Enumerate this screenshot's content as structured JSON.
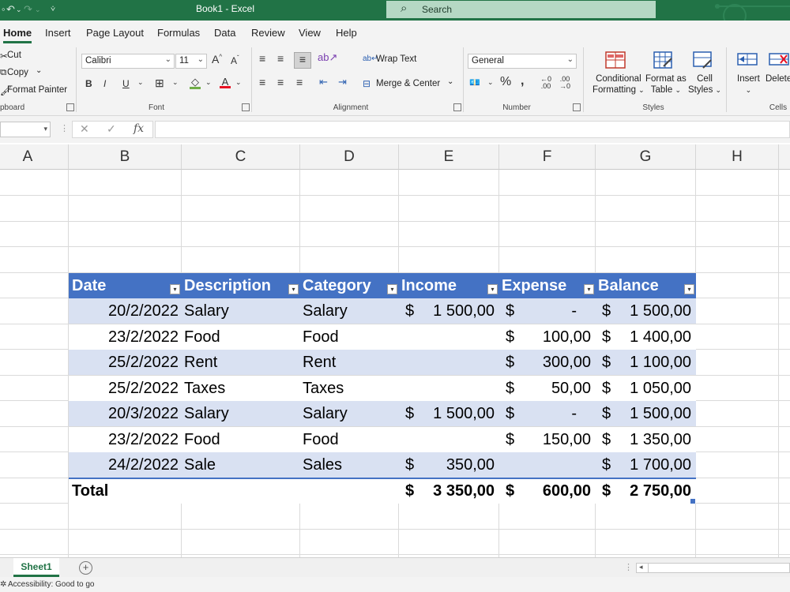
{
  "titlebar": {
    "title": "Book1  -  Excel",
    "search_placeholder": "Search",
    "accent": "#217346",
    "qa_undo": "↶",
    "qa_redo": "↷",
    "qa_more": "⩒"
  },
  "ribbon_tabs": [
    "Home",
    "Insert",
    "Page Layout",
    "Formulas",
    "Data",
    "Review",
    "View",
    "Help"
  ],
  "clipboard": {
    "cut": "Cut",
    "copy": "Copy",
    "format_painter": "Format Painter",
    "label": "pboard"
  },
  "font": {
    "name": "Calibri",
    "size": "11",
    "label": "Font",
    "bold": "B",
    "italic": "I",
    "underline": "U",
    "grow": "A",
    "shrink": "A"
  },
  "alignment": {
    "wrap_text": "Wrap Text",
    "merge_center": "Merge & Center",
    "label": "Alignment"
  },
  "number": {
    "format": "General",
    "label": "Number"
  },
  "styles": {
    "conditional_formatting": [
      "Conditional",
      "Formatting"
    ],
    "format_as_table": [
      "Format as",
      "Table"
    ],
    "cell_styles": [
      "Cell",
      "Styles"
    ],
    "label": "Styles"
  },
  "cells": {
    "insert": "Insert",
    "delete": "Delete",
    "label": "Cells"
  },
  "formula_bar": {
    "name_box": "",
    "fx": "fx",
    "cancel": "✕",
    "enter": "✓",
    "value": ""
  },
  "columns": [
    "A",
    "B",
    "C",
    "D",
    "E",
    "F",
    "G",
    "H"
  ],
  "table": {
    "header_color": "#4472c4",
    "band_color": "#d9e1f2",
    "headers": [
      "Date",
      "Description",
      "Category",
      "Income",
      "Expense",
      "Balance"
    ],
    "rows": [
      {
        "date": "20/2/2022",
        "description": "Salary",
        "category": "Salary",
        "income": "1 500,00",
        "expense": "-",
        "balance": "1 500,00"
      },
      {
        "date": "23/2/2022",
        "description": "Food",
        "category": "Food",
        "income": "",
        "expense": "100,00",
        "balance": "1 400,00"
      },
      {
        "date": "25/2/2022",
        "description": "Rent",
        "category": "Rent",
        "income": "",
        "expense": "300,00",
        "balance": "1 100,00"
      },
      {
        "date": "25/2/2022",
        "description": "Taxes",
        "category": "Taxes",
        "income": "",
        "expense": "50,00",
        "balance": "1 050,00"
      },
      {
        "date": "20/3/2022",
        "description": "Salary",
        "category": "Salary",
        "income": "1 500,00",
        "expense": "-",
        "balance": "1 500,00"
      },
      {
        "date": "23/2/2022",
        "description": "Food",
        "category": "Food",
        "income": "",
        "expense": "150,00",
        "balance": "1 350,00"
      },
      {
        "date": "24/2/2022",
        "description": "Sale",
        "category": "Sales",
        "income": "350,00",
        "expense": "",
        "balance": "1 700,00"
      }
    ],
    "total": {
      "label": "Total",
      "income": "3 350,00",
      "expense": "600,00",
      "balance": "2 750,00"
    },
    "currency": "$"
  },
  "sheets": [
    "Sheet1"
  ],
  "status": {
    "accessibility": "Accessibility: Good to go"
  }
}
